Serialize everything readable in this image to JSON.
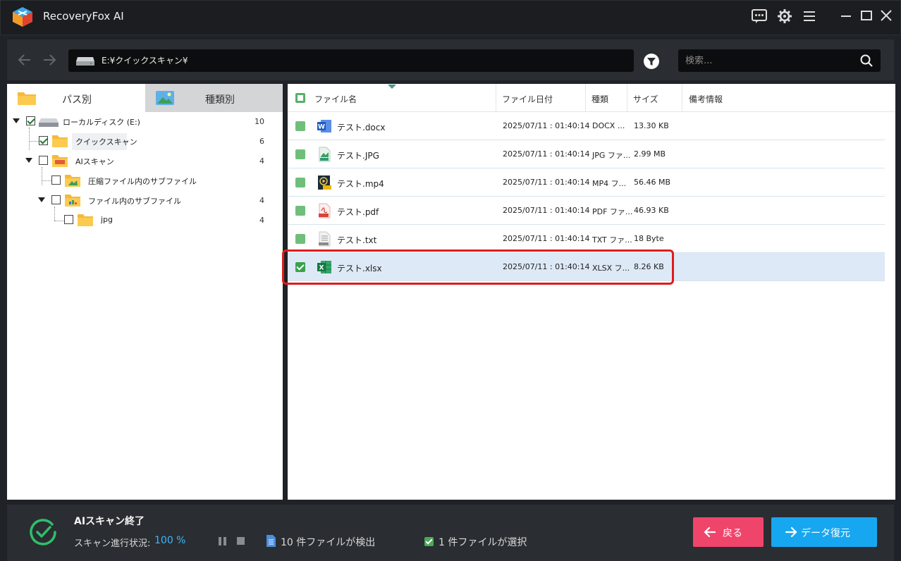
{
  "app": {
    "title": "RecoveryFox AI"
  },
  "pathbar": {
    "path": "E:¥クイックスキャン¥",
    "search_placeholder": "検索..."
  },
  "left": {
    "tabs": [
      {
        "label": "パス別"
      },
      {
        "label": "種類別"
      }
    ],
    "tree": [
      {
        "label": "ローカルディスク (E:)",
        "count": "10",
        "checked": true
      },
      {
        "label": "クイックスキャン",
        "count": "6",
        "checked": true
      },
      {
        "label": "AIスキャン",
        "count": "4",
        "checked": false
      },
      {
        "label": "圧縮ファイル内のサブファイル",
        "count": "",
        "checked": false
      },
      {
        "label": "ファイル内のサブファイル",
        "count": "4",
        "checked": false
      },
      {
        "label": "jpg",
        "count": "4",
        "checked": false
      }
    ]
  },
  "table": {
    "headers": {
      "name": "ファイル名",
      "date": "ファイル日付",
      "type": "種類",
      "size": "サイズ",
      "note": "備考情報"
    },
    "rows": [
      {
        "name": "テスト.docx",
        "date": "2025/07/11 : 01:40:14",
        "type": "DOCX ...",
        "size": "13.30 KB",
        "icon": "word-icon",
        "selected": false
      },
      {
        "name": "テスト.JPG",
        "date": "2025/07/11 : 01:40:14",
        "type": "JPG ファ...",
        "size": "2.99 MB",
        "icon": "jpg-icon",
        "selected": false
      },
      {
        "name": "テスト.mp4",
        "date": "2025/07/11 : 01:40:14",
        "type": "MP4 フ...",
        "size": "56.46 MB",
        "icon": "mp4-icon",
        "selected": false
      },
      {
        "name": "テスト.pdf",
        "date": "2025/07/11 : 01:40:14",
        "type": "PDF ファ...",
        "size": "46.93 KB",
        "icon": "pdf-icon",
        "selected": false
      },
      {
        "name": "テスト.txt",
        "date": "2025/07/11 : 01:40:14",
        "type": "TXT ファ...",
        "size": "18 Byte",
        "icon": "txt-icon",
        "selected": false
      },
      {
        "name": "テスト.xlsx",
        "date": "2025/07/11 : 01:40:14",
        "type": "XLSX フ...",
        "size": "8.26 KB",
        "icon": "excel-icon",
        "selected": true
      }
    ]
  },
  "status": {
    "title": "AIスキャン終了",
    "progress_label": "スキャン進行状況:",
    "progress_value": "100 %",
    "found_text": "10 件ファイルが検出",
    "selected_text": "1 件ファイルが選択"
  },
  "buttons": {
    "back": "戻る",
    "recover": "データ復元"
  },
  "colors": {
    "accent_blue": "#17a7f0",
    "back_pink": "#f0456b",
    "check_green": "#3aa24b",
    "highlight_red": "#e11b1b"
  }
}
